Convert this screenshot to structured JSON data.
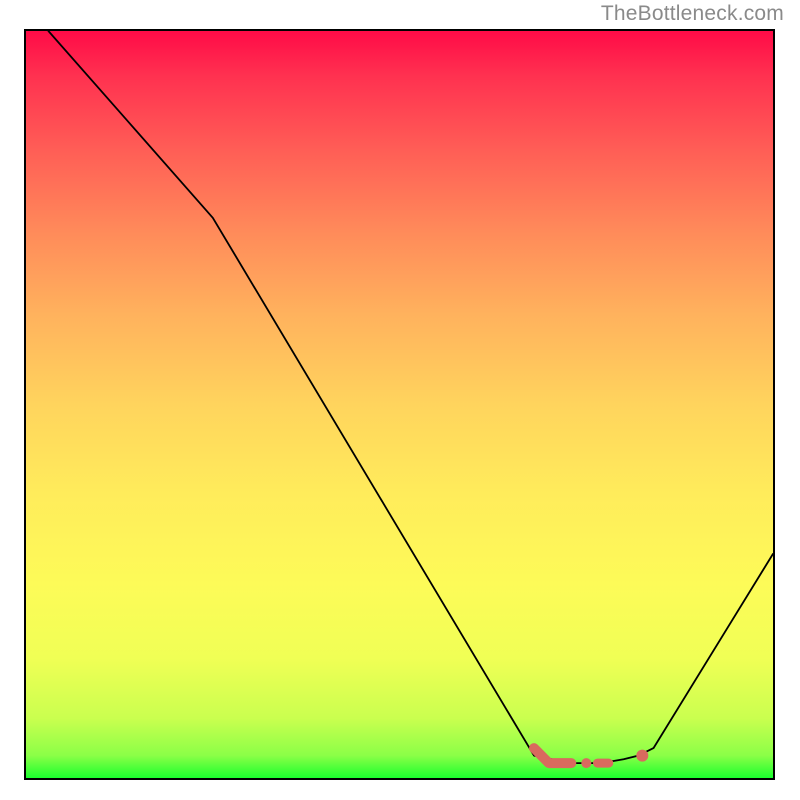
{
  "attribution": "TheBottleneck.com",
  "chart_data": {
    "type": "line",
    "title": "",
    "xlabel": "",
    "ylabel": "",
    "xlim": [
      0,
      100
    ],
    "ylim": [
      0,
      100
    ],
    "grid": false,
    "legend": "none",
    "background": "ryg-gradient",
    "series": [
      {
        "name": "bottleneck-curve",
        "x": [
          3,
          25,
          68,
          73,
          77,
          80,
          82,
          84,
          100
        ],
        "values": [
          100,
          75,
          3,
          2,
          2,
          2.5,
          3,
          4,
          30
        ],
        "color": "#000000",
        "stroke_width": 1.8
      }
    ],
    "markers": [
      {
        "kind": "thick-segment",
        "color": "#d96a5e",
        "width": 10,
        "x": [
          68,
          70,
          73
        ],
        "y": [
          4,
          2,
          2
        ]
      },
      {
        "kind": "dot",
        "color": "#d96a5e",
        "r": 5,
        "x": 75,
        "y": 2
      },
      {
        "kind": "thick-segment",
        "color": "#d96a5e",
        "width": 9,
        "x": [
          76.5,
          78
        ],
        "y": [
          2,
          2
        ]
      },
      {
        "kind": "dot",
        "color": "#d96a5e",
        "r": 6,
        "x": 82.5,
        "y": 3
      }
    ]
  }
}
